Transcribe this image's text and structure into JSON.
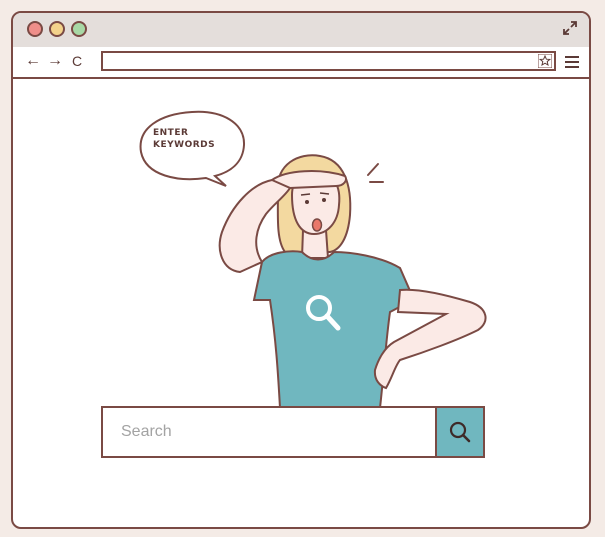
{
  "browser": {
    "nav": {
      "back": "←",
      "forward": "→",
      "reload": "C"
    },
    "icons": {
      "traffic_lights": [
        "red",
        "yellow",
        "green"
      ],
      "expand": "expand-icon",
      "bookmark": "star-icon",
      "menu": "hamburger-icon"
    }
  },
  "illustration": {
    "bubble_line1": "ENTER",
    "bubble_line2": "KEYWORDS",
    "shirt_icon": "search-icon"
  },
  "search": {
    "placeholder": "Search",
    "button_icon": "search-icon"
  },
  "colors": {
    "outline": "#7a4a44",
    "shirt": "#70b7bf",
    "skin": "#fbeae6",
    "hair": "#f3d9a0",
    "titlebar": "#e4dedb"
  }
}
